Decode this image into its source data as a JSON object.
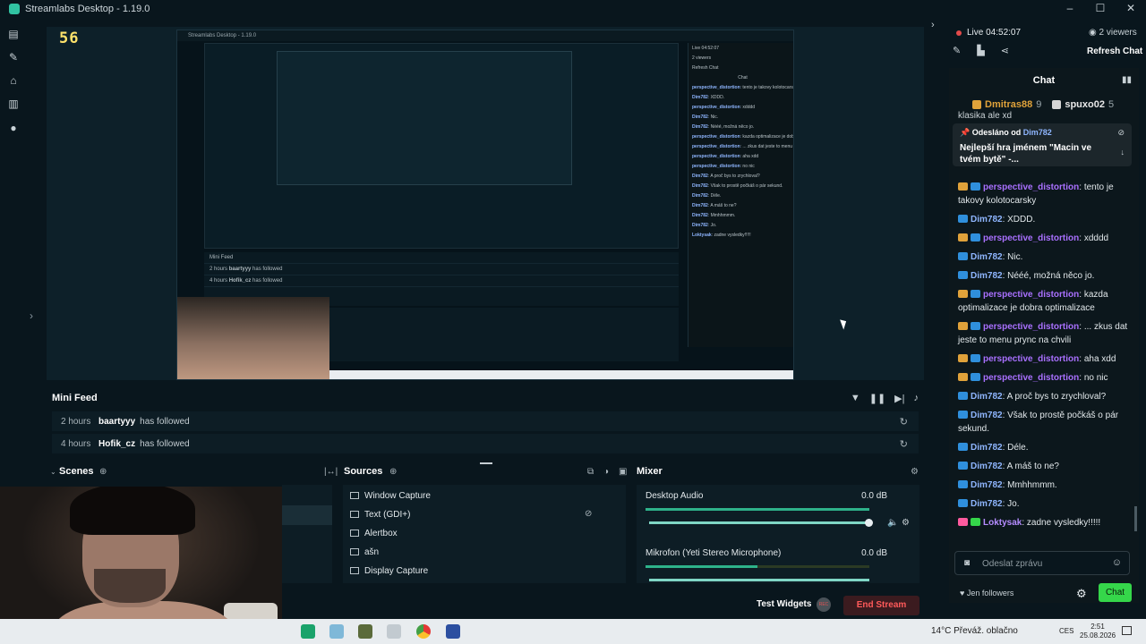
{
  "titlebar": {
    "title": "Streamlabs Desktop - 1.19.0",
    "minimize": "–",
    "maximize": "☐",
    "close": "✕"
  },
  "preview": {
    "counter_big": "56",
    "counter_small": "56",
    "nested_title": "Streamlabs Desktop - 1.19.0",
    "nested_feed_title": "Mini Feed",
    "nested_feed": [
      {
        "time": "2 hours",
        "user": "baartyyy",
        "text": "has followed"
      },
      {
        "time": "4 hours",
        "user": "Hofik_cz",
        "text": "has followed"
      }
    ],
    "nested_chat_title": "Chat",
    "nested_live": "Live 04:52:07",
    "nested_viewers": "2 viewers",
    "nested_refresh": "Refresh Chat",
    "nested_chat_lines": [
      {
        "u": "perspective_distortion",
        "t": "tento je takovy kolotocarsky"
      },
      {
        "u": "Dim782",
        "t": "XDDD."
      },
      {
        "u": "perspective_distortion",
        "t": "xdddd"
      },
      {
        "u": "Dim782",
        "t": "Nic."
      },
      {
        "u": "Dim782",
        "t": "Nééé, možná něco jo."
      },
      {
        "u": "perspective_distortion",
        "t": "kazda optimalizace je dobra optimalizace"
      },
      {
        "u": "perspective_distortion",
        "t": "... zkus dat jeste to menu prync na chvili"
      },
      {
        "u": "perspective_distortion",
        "t": "aha xdd"
      },
      {
        "u": "perspective_distortion",
        "t": "no nic"
      },
      {
        "u": "Dim782",
        "t": "A proč bys to zrychloval?"
      },
      {
        "u": "Dim782",
        "t": "Však to prostě počkáš o pár sekund."
      },
      {
        "u": "Dim782",
        "t": "Déle."
      },
      {
        "u": "Dim782",
        "t": "A máš to ne?"
      },
      {
        "u": "Dim782",
        "t": "Mmhhmmm."
      },
      {
        "u": "Dim782",
        "t": "Jo."
      },
      {
        "u": "Loktysak",
        "t": "zadne vysledky!!!!!"
      }
    ]
  },
  "minifeed": {
    "title": "Mini Feed",
    "rows": [
      {
        "time": "2 hours",
        "user": "baartyyy",
        "text": "has followed"
      },
      {
        "time": "4 hours",
        "user": "Hofik_cz",
        "text": "has followed"
      }
    ]
  },
  "docks": {
    "scenes_title": "Scenes",
    "sources_title": "Sources",
    "mixer_title": "Mixer",
    "sources": [
      "Window Capture",
      "Text (GDI+)",
      "Alertbox",
      "ašn",
      "Display Capture"
    ],
    "mixer": [
      {
        "name": "Desktop Audio",
        "db": "0.0 dB",
        "level": 1.0,
        "volume": 1.0
      },
      {
        "name": "Mikrofon (Yeti Stereo Microphone)",
        "db": "0.0 dB",
        "level": 0.5,
        "volume": 1.0
      }
    ]
  },
  "footer": {
    "test_widgets": "Test Widgets",
    "rec": "REC",
    "end_stream": "End Stream"
  },
  "taskbar": {
    "weather": "14°C  Převáž. oblačno",
    "lang": "CES",
    "time": "2:51",
    "date": "25.08.2026"
  },
  "chat_panel": {
    "live": "Live 04:52:07",
    "viewers": "2 viewers",
    "refresh": "Refresh Chat",
    "title": "Chat",
    "top_users": [
      {
        "name": "Dmitras88",
        "count": "9",
        "color": "#e0a23a"
      },
      {
        "name": "spuxo02",
        "count": "5",
        "color": "#d6d6d6"
      }
    ],
    "partial_line": "klasika ale xd",
    "pinned": {
      "prefix": "Odesláno od",
      "user": "Dim782",
      "text": "Nejlepší hra jménem \"Macin ve tvém bytě\" -..."
    },
    "messages": [
      {
        "user": "perspective_distortion",
        "text": "tento je takovy kolotocarsky",
        "color": "#a970ff",
        "badges": [
          "#e0a23a",
          "#2f8fdc"
        ]
      },
      {
        "user": "Dim782",
        "text": "XDDD.",
        "color": "#8fb6ff",
        "badges": [
          "#2f8fdc"
        ]
      },
      {
        "user": "perspective_distortion",
        "text": "xdddd",
        "color": "#a970ff",
        "badges": [
          "#e0a23a",
          "#2f8fdc"
        ]
      },
      {
        "user": "Dim782",
        "text": "Nic.",
        "color": "#8fb6ff",
        "badges": [
          "#2f8fdc"
        ]
      },
      {
        "user": "Dim782",
        "text": "Nééé, možná něco jo.",
        "color": "#8fb6ff",
        "badges": [
          "#2f8fdc"
        ]
      },
      {
        "user": "perspective_distortion",
        "text": "kazda optimalizace je dobra optimalizace",
        "color": "#a970ff",
        "badges": [
          "#e0a23a",
          "#2f8fdc"
        ]
      },
      {
        "user": "perspective_distortion",
        "text": "... zkus dat jeste to menu prync na chvili",
        "color": "#a970ff",
        "badges": [
          "#e0a23a",
          "#2f8fdc"
        ]
      },
      {
        "user": "perspective_distortion",
        "text": "aha xdd",
        "color": "#a970ff",
        "badges": [
          "#e0a23a",
          "#2f8fdc"
        ]
      },
      {
        "user": "perspective_distortion",
        "text": "no nic",
        "color": "#a970ff",
        "badges": [
          "#e0a23a",
          "#2f8fdc"
        ]
      },
      {
        "user": "Dim782",
        "text": "A proč bys to zrychloval?",
        "color": "#8fb6ff",
        "badges": [
          "#2f8fdc"
        ]
      },
      {
        "user": "Dim782",
        "text": "Však to prostě počkáš o pár sekund.",
        "color": "#8fb6ff",
        "badges": [
          "#2f8fdc"
        ]
      },
      {
        "user": "Dim782",
        "text": "Déle.",
        "color": "#8fb6ff",
        "badges": [
          "#2f8fdc"
        ]
      },
      {
        "user": "Dim782",
        "text": "A máš to ne?",
        "color": "#8fb6ff",
        "badges": [
          "#2f8fdc"
        ]
      },
      {
        "user": "Dim782",
        "text": "Mmhhmmm.",
        "color": "#8fb6ff",
        "badges": [
          "#2f8fdc"
        ]
      },
      {
        "user": "Dim782",
        "text": "Jo.",
        "color": "#8fb6ff",
        "badges": [
          "#2f8fdc"
        ]
      },
      {
        "user": "Loktysak",
        "text": "zadne vysledky!!!!!",
        "color": "#b58cff",
        "badges": [
          "#ff5a9e",
          "#35d64a"
        ]
      }
    ],
    "followers": "Jen followers",
    "input_placeholder": "Odeslat zprávu",
    "send": "Chat"
  },
  "colors": {
    "accent": "#31c3a2",
    "live": "#e24a4a",
    "send": "#35d64a",
    "end_stream": "#ff5a5a"
  }
}
